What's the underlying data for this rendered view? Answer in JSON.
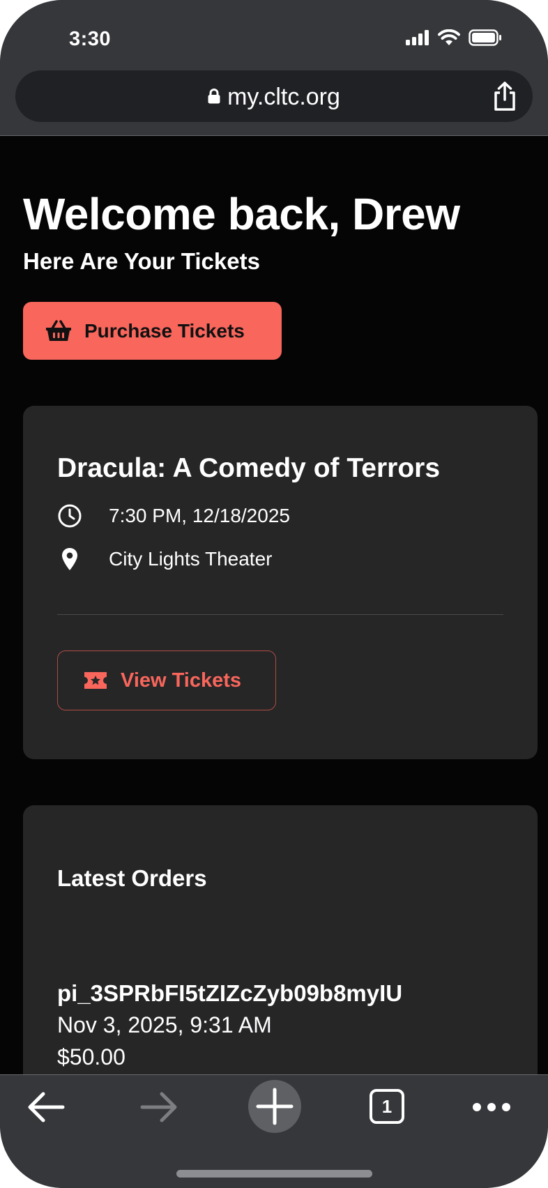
{
  "status_bar": {
    "time": "3:30",
    "icons": [
      "signal-icon",
      "wifi-icon",
      "battery-icon"
    ]
  },
  "browser": {
    "url": "my.cltc.org",
    "icons": [
      "lock-icon",
      "share-icon"
    ]
  },
  "header": {
    "title": "Welcome back, Drew",
    "subtitle": "Here Are Your Tickets"
  },
  "purchase_button": {
    "label": "Purchase Tickets",
    "icon": "basket-icon"
  },
  "event": {
    "title": "Dracula: A Comedy of Terrors",
    "time": "7:30 PM, 12/18/2025",
    "venue": "City Lights Theater",
    "view_button_label": "View Tickets"
  },
  "orders": {
    "title": "Latest Orders",
    "items": [
      {
        "id": "pi_3SPRbFI5tZIZcZyb09b8myIU",
        "date": "Nov 3, 2025, 9:31 AM",
        "amount": "$50.00"
      }
    ]
  },
  "toolbar": {
    "tab_count": "1",
    "icons": [
      "back-arrow-icon",
      "forward-arrow-icon",
      "new-tab-icon",
      "tabs-icon",
      "more-icon"
    ]
  },
  "colors": {
    "accent": "#f9665c",
    "background": "#050505",
    "card": "#262627",
    "chrome": "#36373b"
  }
}
